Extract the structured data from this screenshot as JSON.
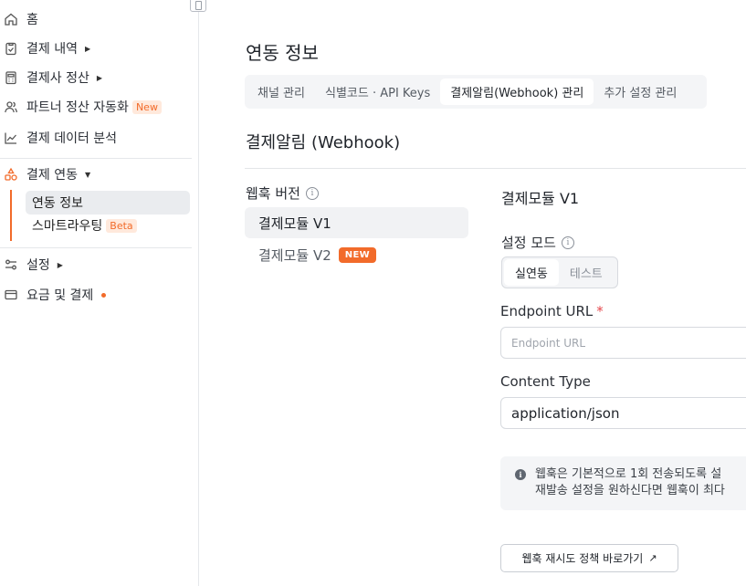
{
  "sidebar": {
    "items": {
      "home": "홈",
      "payment_history": "결제 내역",
      "pg_settlement": "결제사 정산",
      "partner_settlement": "파트너 정산 자동화",
      "partner_badge": "New",
      "analytics": "결제 데이터 분석",
      "integration": "결제 연동",
      "settings": "설정",
      "billing": "요금 및 결제"
    },
    "sub_items": {
      "integration_info": "연동 정보",
      "smart_routing": "스마트라우팅",
      "smart_routing_badge": "Beta"
    },
    "accent_color": "#f26b2a"
  },
  "main": {
    "page_title": "연동 정보",
    "tabs": [
      {
        "label": "채널 관리"
      },
      {
        "label": "식별코드 · API Keys"
      },
      {
        "label": "결제알림(Webhook) 관리"
      },
      {
        "label": "추가 설정 관리"
      }
    ],
    "active_tab": "결제알림(Webhook) 관리",
    "section_title": "결제알림 (Webhook)",
    "version_label": "웹훅 버전",
    "versions": [
      {
        "label": "결제모듈 V1"
      },
      {
        "label": "결제모듈 V2",
        "badge": "NEW"
      }
    ],
    "detail": {
      "title": "결제모듈 V1",
      "mode_label": "설정 모드",
      "modes": [
        "실연동",
        "테스트"
      ],
      "selected_mode": "실연동",
      "endpoint_label": "Endpoint URL",
      "endpoint_required": "*",
      "endpoint_placeholder": "Endpoint URL",
      "content_type_label": "Content Type",
      "content_type_value": "application/json",
      "notice_line1": "웹훅은 기본적으로 1회 전송되도록 설",
      "notice_line2": "재발송 설정을 원하신다면 웹훅이 최다",
      "policy_button": "웹훅 재시도 정책 바로가기"
    }
  }
}
